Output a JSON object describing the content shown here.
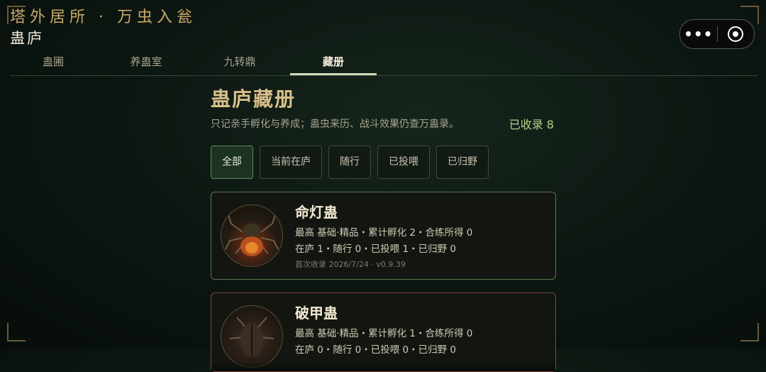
{
  "header": {
    "app_title": "塔外居所 · 万虫入瓮",
    "sub_title": "蛊庐"
  },
  "capsule": {
    "more_icon": "more-dots-icon",
    "target_icon": "target-icon"
  },
  "tabs": [
    {
      "label": "蛊圃",
      "active": false
    },
    {
      "label": "养蛊室",
      "active": false
    },
    {
      "label": "九转鼎",
      "active": false
    },
    {
      "label": "藏册",
      "active": true
    }
  ],
  "main": {
    "title": "蛊庐藏册",
    "description": "只记亲手孵化与养成；蛊虫来历、战斗效果仍查万蛊录。",
    "count": "已收录 8"
  },
  "filters": [
    {
      "label": "全部",
      "active": true
    },
    {
      "label": "当前在庐",
      "active": false
    },
    {
      "label": "随行",
      "active": false
    },
    {
      "label": "已投喂",
      "active": false
    },
    {
      "label": "已归野",
      "active": false
    }
  ],
  "cards": [
    {
      "name": "命灯蛊",
      "line1": "最高 基础·精品・累计孵化 2・合练所得 0",
      "line2": "在庐 1・随行 0・已投喂 1・已归野 0",
      "meta": "首次收录 2026/7/24 · v0.9.39"
    },
    {
      "name": "破甲蛊",
      "line1": "最高 基础·精品・累计孵化 1・合练所得 0",
      "line2": "在庐 0・随行 0・已投喂 0・已归野 0"
    }
  ]
}
